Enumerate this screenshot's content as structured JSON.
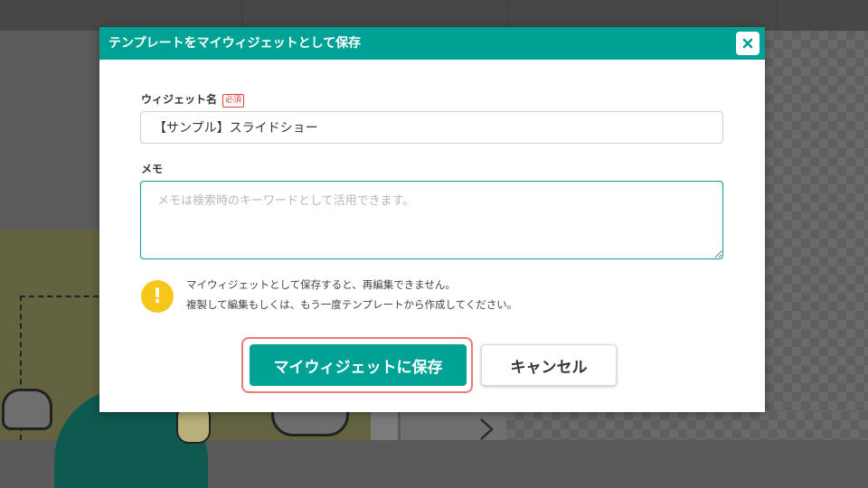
{
  "dialog": {
    "title": "テンプレートをマイウィジェットとして保存",
    "close_label": "×"
  },
  "form": {
    "name_label": "ウィジェット名",
    "required_badge": "必須",
    "name_value": "【サンプル】スライドショー",
    "memo_label": "メモ",
    "memo_placeholder": "メモは検索時のキーワードとして活用できます。",
    "memo_value": ""
  },
  "warning": {
    "line1": "マイウィジェットとして保存すると、再編集できません。",
    "line2": "複製して編集もしくは、もう一度テンプレートから作成してください。"
  },
  "buttons": {
    "save_label": "マイウィジェットに保存",
    "cancel_label": "キャンセル"
  },
  "colors": {
    "accent": "#00a295",
    "warning": "#f7c61a",
    "required": "#e0443a",
    "highlight_ring": "#e97a7a"
  },
  "icons": {
    "close": "close-icon",
    "warning": "exclamation-icon",
    "resize": "resize-handle-icon",
    "chevron": "chevron-right-icon"
  }
}
